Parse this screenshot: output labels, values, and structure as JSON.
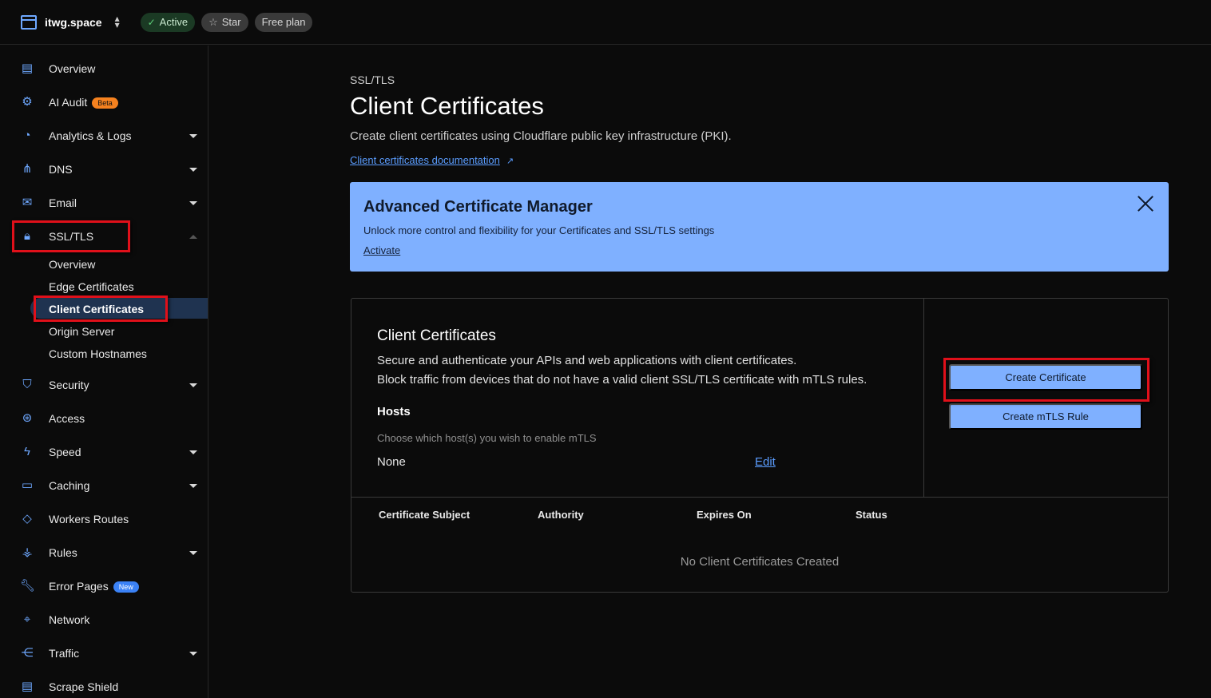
{
  "topbar": {
    "site_name": "itwg.space",
    "status_label": "Active",
    "star_label": "Star",
    "plan_label": "Free plan"
  },
  "sidebar": {
    "items": [
      {
        "label": "Overview",
        "icon": "clipboard-icon"
      },
      {
        "label": "AI Audit",
        "icon": "robot-icon",
        "badge": "Beta"
      },
      {
        "label": "Analytics & Logs",
        "icon": "pie-chart-icon"
      },
      {
        "label": "DNS",
        "icon": "network-tree-icon"
      },
      {
        "label": "Email",
        "icon": "envelope-icon"
      },
      {
        "label": "SSL/TLS",
        "icon": "lock-icon"
      },
      {
        "label": "Security",
        "icon": "shield-icon"
      },
      {
        "label": "Access",
        "icon": "access-icon"
      },
      {
        "label": "Speed",
        "icon": "lightning-icon"
      },
      {
        "label": "Caching",
        "icon": "server-icon"
      },
      {
        "label": "Workers Routes",
        "icon": "workers-icon"
      },
      {
        "label": "Rules",
        "icon": "rules-icon"
      },
      {
        "label": "Error Pages",
        "icon": "wrench-icon",
        "badge": "New"
      },
      {
        "label": "Network",
        "icon": "location-pin-icon"
      },
      {
        "label": "Traffic",
        "icon": "traffic-icon"
      },
      {
        "label": "Scrape Shield",
        "icon": "document-icon"
      }
    ],
    "ssl_subitems": [
      "Overview",
      "Edge Certificates",
      "Client Certificates",
      "Origin Server",
      "Custom Hostnames"
    ]
  },
  "main": {
    "breadcrumb": "SSL/TLS",
    "title": "Client Certificates",
    "description": "Create client certificates using Cloudflare public key infrastructure (PKI).",
    "doc_link": "Client certificates documentation",
    "banner": {
      "title": "Advanced Certificate Manager",
      "text": "Unlock more control and flexibility for your Certificates and SSL/TLS settings",
      "link": "Activate"
    },
    "card": {
      "title": "Client Certificates",
      "text1": "Secure and authenticate your APIs and web applications with client certificates.",
      "text2": "Block traffic from devices that do not have a valid client SSL/TLS certificate with mTLS rules.",
      "hosts_label": "Hosts",
      "hosts_hint": "Choose which host(s) you wish to enable mTLS",
      "hosts_value": "None",
      "edit_label": "Edit",
      "create_certificate_label": "Create Certificate",
      "create_mtls_label": "Create mTLS Rule"
    },
    "table": {
      "columns": [
        "Certificate Subject",
        "Authority",
        "Expires On",
        "Status"
      ],
      "empty_text": "No Client Certificates Created"
    }
  },
  "colors": {
    "accent": "#6ea8ff",
    "banner_bg": "#7fb0ff",
    "highlight": "#e0101a"
  }
}
